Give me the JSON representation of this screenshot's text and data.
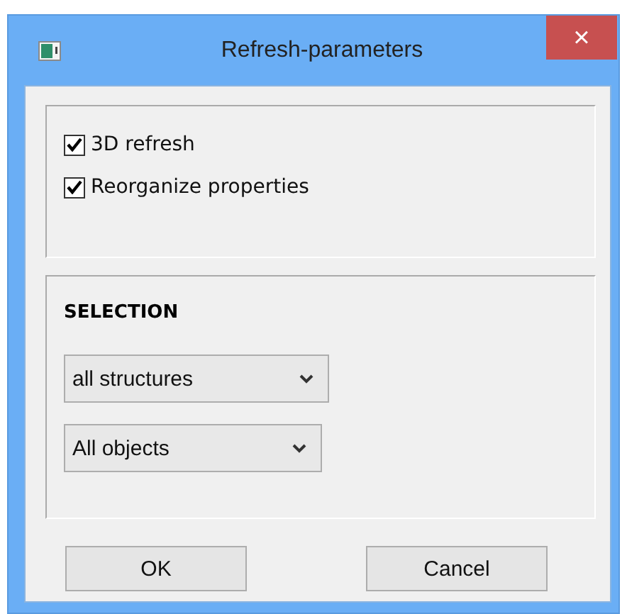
{
  "window": {
    "title": "Refresh-parameters",
    "close": "×"
  },
  "options": [
    {
      "label": "3D refresh",
      "checked": true
    },
    {
      "label": "Reorganize properties",
      "checked": true
    }
  ],
  "selection": {
    "heading": "SELECTION",
    "dropdowns": [
      {
        "value": "all structures"
      },
      {
        "value": "All objects"
      }
    ]
  },
  "buttons": [
    "OK",
    "Cancel"
  ]
}
